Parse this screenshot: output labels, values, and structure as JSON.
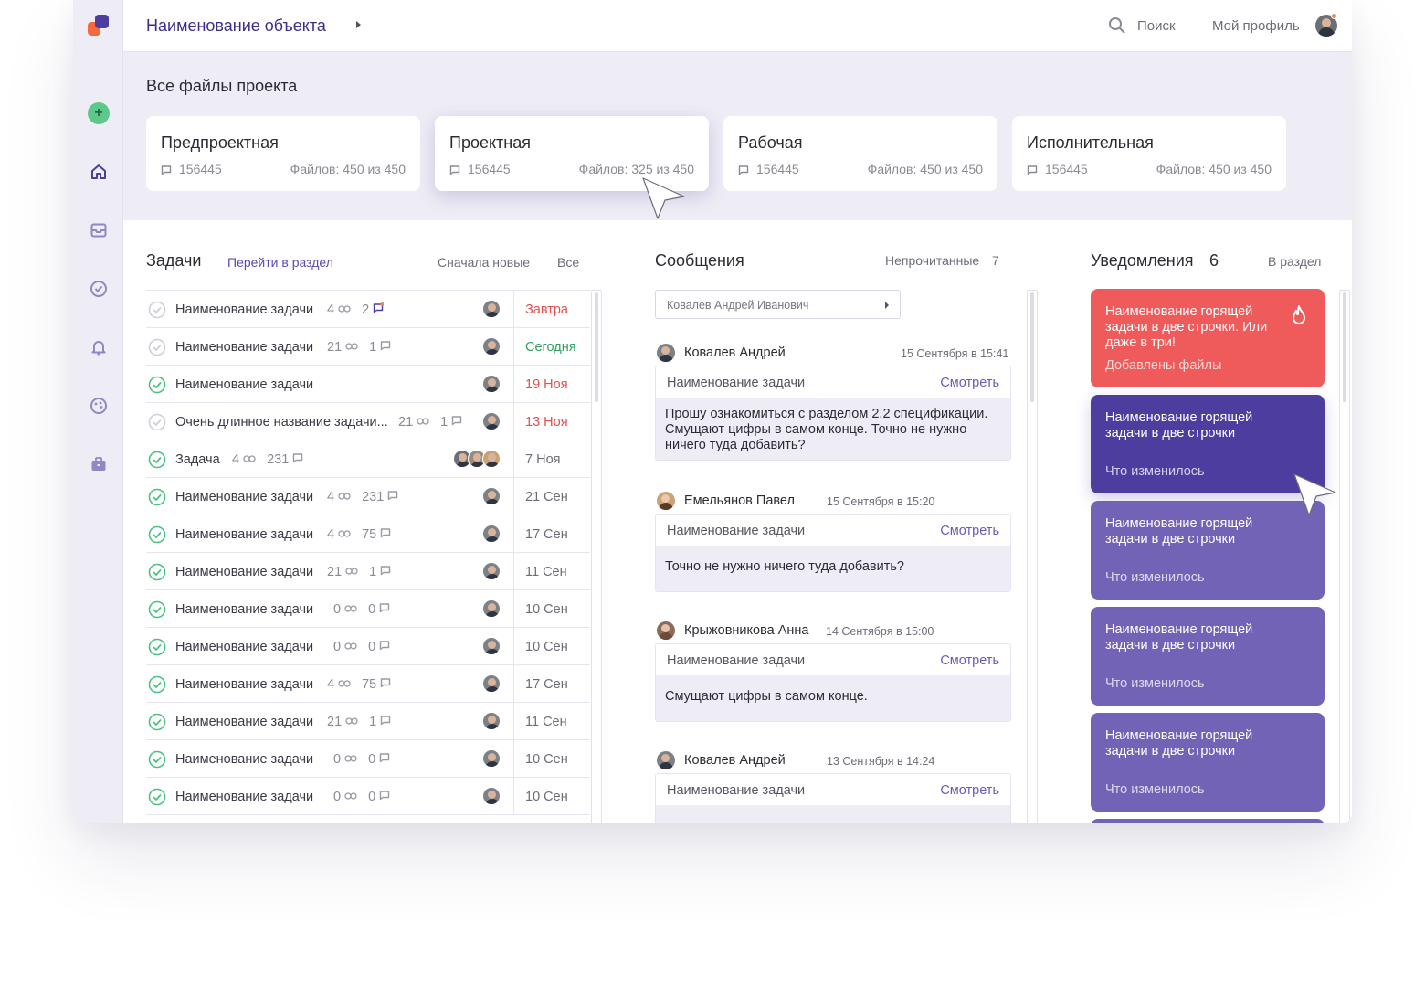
{
  "header": {
    "title": "Наименование объекта",
    "search_label": "Поиск",
    "profile_label": "Мой профиль"
  },
  "sidebar": {
    "items": [
      {
        "icon": "plus-icon"
      },
      {
        "icon": "home-icon"
      },
      {
        "icon": "inbox-icon"
      },
      {
        "icon": "check-circle-icon"
      },
      {
        "icon": "bell-icon"
      },
      {
        "icon": "palette-icon"
      },
      {
        "icon": "briefcase-icon"
      }
    ]
  },
  "files": {
    "title": "Все файлы проекта",
    "cards": [
      {
        "name": "Предпроектная",
        "count": "156445",
        "files": "Файлов: 450 из 450"
      },
      {
        "name": "Проектная",
        "count": "156445",
        "files": "Файлов: 325 из 450"
      },
      {
        "name": "Рабочая",
        "count": "156445",
        "files": "Файлов: 450 из 450"
      },
      {
        "name": "Исполнительная",
        "count": "156445",
        "files": "Файлов: 450 из 450"
      }
    ]
  },
  "tasks": {
    "title": "Задачи",
    "link": "Перейти в раздел",
    "sort": "Сначала новые",
    "filter": "Все",
    "rows": [
      {
        "name": "Наименование задачи",
        "links": "4",
        "comments": "2",
        "done": false,
        "date": "Завтра",
        "date_color": "red"
      },
      {
        "name": "Наименование задачи",
        "links": "21",
        "comments": "1",
        "done": false,
        "date": "Сегодня",
        "date_color": "green"
      },
      {
        "name": "Наименование задачи",
        "links": "",
        "comments": "",
        "done": true,
        "date": "19 Ноя",
        "date_color": "red"
      },
      {
        "name": "Очень длинное название задачи...",
        "links": "21",
        "comments": "1",
        "done": false,
        "date": "13 Ноя",
        "date_color": "red"
      },
      {
        "name": "Задача",
        "links": "4",
        "comments": "231",
        "done": true,
        "date": "7 Ноя",
        "date_color": "gray"
      },
      {
        "name": "Наименование задачи",
        "links": "4",
        "comments": "231",
        "done": true,
        "date": "21 Сен",
        "date_color": "gray"
      },
      {
        "name": "Наименование задачи",
        "links": "4",
        "comments": "75",
        "done": true,
        "date": "17 Сен",
        "date_color": "gray"
      },
      {
        "name": "Наименование задачи",
        "links": "21",
        "comments": "1",
        "done": true,
        "date": "11 Сен",
        "date_color": "gray"
      },
      {
        "name": "Наименование задачи",
        "links": "0",
        "comments": "0",
        "done": true,
        "date": "10 Сен",
        "date_color": "gray"
      },
      {
        "name": "Наименование задачи",
        "links": "0",
        "comments": "0",
        "done": true,
        "date": "10 Сен",
        "date_color": "gray"
      },
      {
        "name": "Наименование задачи",
        "links": "4",
        "comments": "75",
        "done": true,
        "date": "17 Сен",
        "date_color": "gray"
      },
      {
        "name": "Наименование задачи",
        "links": "21",
        "comments": "1",
        "done": true,
        "date": "11 Сен",
        "date_color": "gray"
      },
      {
        "name": "Наименование задачи",
        "links": "0",
        "comments": "0",
        "done": true,
        "date": "10 Сен",
        "date_color": "gray"
      },
      {
        "name": "Наименование задачи",
        "links": "0",
        "comments": "0",
        "done": true,
        "date": "10 Сен",
        "date_color": "gray"
      }
    ]
  },
  "messages": {
    "title": "Сообщения",
    "unread_label": "Непрочитанные",
    "unread_count": "7",
    "select_value": "Ковалев Андрей Иванович",
    "items": [
      {
        "author": "Ковалев Андрей",
        "time": "15 Сентября в 15:41",
        "task": "Наименование задачи",
        "action": "Смотреть",
        "body": "Прошу ознакомиться с разделом 2.2 спецификации. Смущают цифры в самом конце. Точно не нужно ничего туда добавить?"
      },
      {
        "author": "Емельянов Павел",
        "time": "15 Сентября в 15:20",
        "task": "Наименование задачи",
        "action": "Смотреть",
        "body": "Точно не нужно ничего туда добавить?"
      },
      {
        "author": "Крыжовникова Анна",
        "time": "14 Сентября в 15:00",
        "task": "Наименование задачи",
        "action": "Смотреть",
        "body": "Смущают цифры в самом конце."
      },
      {
        "author": "Ковалев Андрей",
        "time": "13 Сентября в 14:24",
        "task": "Наименование задачи",
        "action": "Смотреть",
        "body": ""
      }
    ]
  },
  "notifications": {
    "title": "Уведомления",
    "count": "6",
    "link": "В раздел",
    "items": [
      {
        "text": "Наименование горящей задачи в две строчки. Или даже в три!",
        "sub": "Добавлены файлы",
        "style": "red"
      },
      {
        "text": "Наименование горящей задачи в две строчки",
        "sub": "Что изменилось",
        "style": "dark"
      },
      {
        "text": "Наименование горящей задачи в две строчки",
        "sub": "Что изменилось",
        "style": "mid"
      },
      {
        "text": "Наименование горящей задачи в две строчки",
        "sub": "Что изменилось",
        "style": "mid"
      },
      {
        "text": "Наименование горящей задачи в две строчки",
        "sub": "Что изменилось",
        "style": "mid"
      }
    ]
  },
  "colors": {
    "accent": "#4d3d9e",
    "notif_red": "#ef5b5b",
    "notif_mid": "#7263b6",
    "success": "#2e9e60",
    "danger": "#e3504d",
    "sidebar_bg": "#eeedf5"
  }
}
